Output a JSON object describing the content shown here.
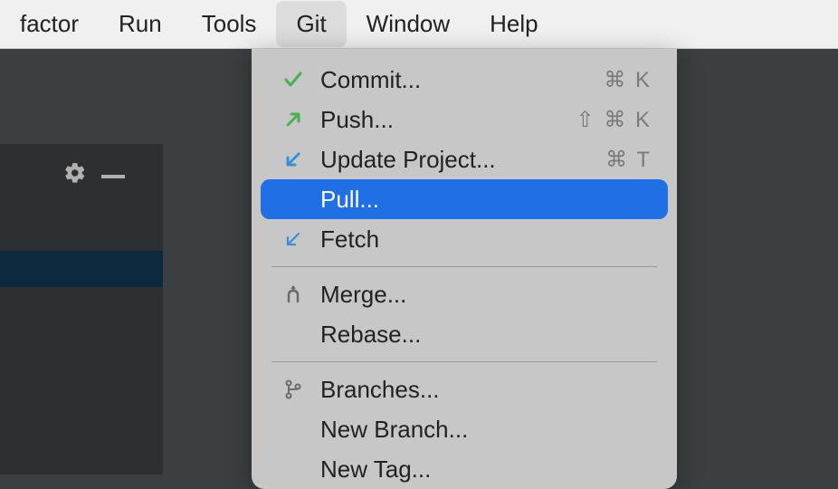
{
  "menubar": {
    "items": [
      {
        "label": "factor",
        "active": false
      },
      {
        "label": "Run",
        "active": false
      },
      {
        "label": "Tools",
        "active": false
      },
      {
        "label": "Git",
        "active": true
      },
      {
        "label": "Window",
        "active": false
      },
      {
        "label": "Help",
        "active": false
      }
    ]
  },
  "dropdown": {
    "items": [
      {
        "type": "item",
        "icon": "check",
        "label": "Commit...",
        "shortcut": "⌘ K"
      },
      {
        "type": "item",
        "icon": "arrow-up-right",
        "label": "Push...",
        "shortcut": "⇧ ⌘ K"
      },
      {
        "type": "item",
        "icon": "arrow-down-left",
        "label": "Update Project...",
        "shortcut": "⌘ T"
      },
      {
        "type": "item",
        "icon": "",
        "label": "Pull...",
        "shortcut": "",
        "highlight": true
      },
      {
        "type": "item",
        "icon": "arrow-down-left-outline",
        "label": "Fetch",
        "shortcut": ""
      },
      {
        "type": "separator"
      },
      {
        "type": "item",
        "icon": "merge",
        "label": "Merge...",
        "shortcut": ""
      },
      {
        "type": "item",
        "icon": "",
        "label": "Rebase...",
        "shortcut": ""
      },
      {
        "type": "separator"
      },
      {
        "type": "item",
        "icon": "branch",
        "label": "Branches...",
        "shortcut": ""
      },
      {
        "type": "item",
        "icon": "",
        "label": "New Branch...",
        "shortcut": ""
      },
      {
        "type": "item",
        "icon": "",
        "label": "New Tag...",
        "shortcut": ""
      }
    ]
  }
}
